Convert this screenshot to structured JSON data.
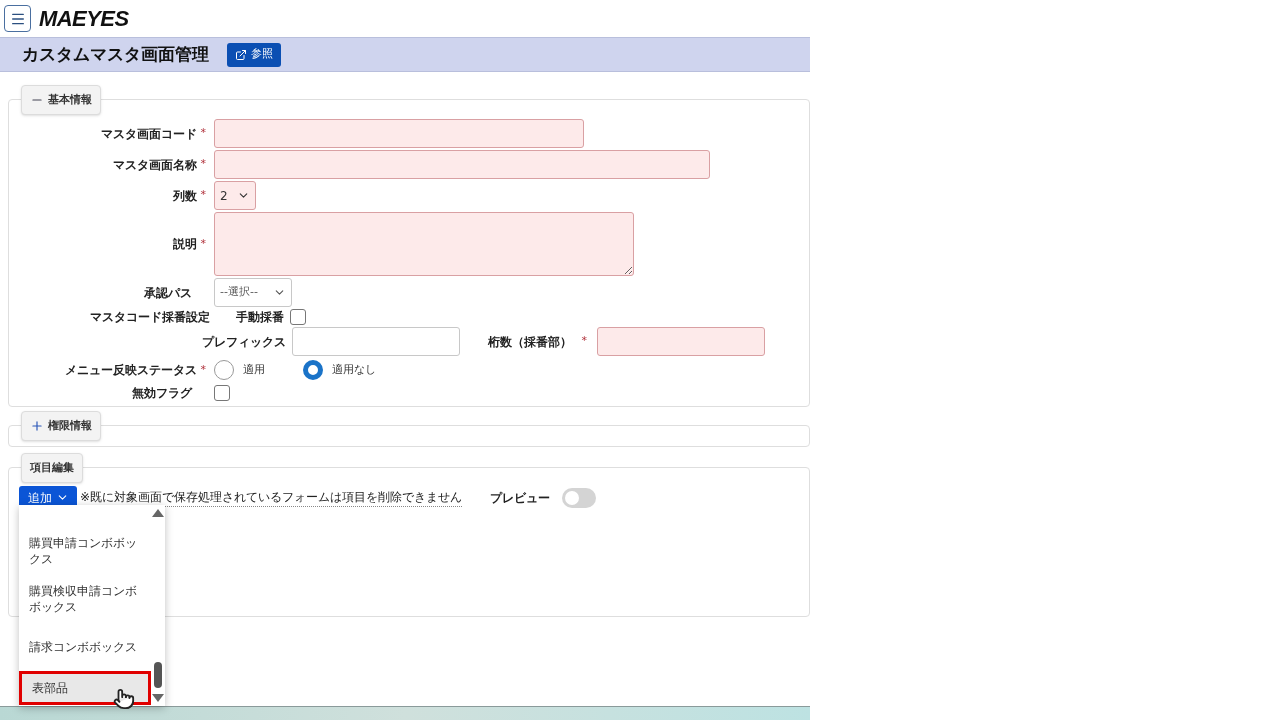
{
  "header": {
    "logo": "MAEYES"
  },
  "page": {
    "title": "カスタムマスタ画面管理",
    "reference_button": "参照"
  },
  "basic_section": {
    "title": "基本情報",
    "expanded": true,
    "code_field": {
      "label": "マスタ画面コード",
      "required_mark": "*"
    },
    "name_field": {
      "label": "マスタ画面名称",
      "required_mark": "*"
    },
    "columns_field": {
      "label": "列数",
      "required_mark": "*",
      "value": "2"
    },
    "description_field": {
      "label": "説明",
      "required_mark": "*"
    },
    "approval_field": {
      "label": "承認パス",
      "value": "--選択--"
    },
    "numbering": {
      "label": "マスタコード採番設定",
      "manual": {
        "label": "手動採番",
        "checked": false
      },
      "prefix": {
        "label": "プレフィックス"
      },
      "digits": {
        "label": "桁数（採番部）",
        "required_mark": "*"
      }
    },
    "menu_status": {
      "label": "メニュー反映ステータス",
      "required_mark": "*",
      "options": [
        {
          "label": "適用",
          "selected": false
        },
        {
          "label": "適用なし",
          "selected": true
        }
      ]
    },
    "disabled_flag": {
      "label": "無効フラグ",
      "checked": false
    }
  },
  "permission_section": {
    "title": "権限情報",
    "expanded": false
  },
  "items_section": {
    "title": "項目編集",
    "add_button": "追加",
    "notice": "※既に対象画面で保存処理されているフォームは項目を削除できません",
    "preview": {
      "label": "プレビュー",
      "on": false
    },
    "dropdown_items": [
      {
        "label": "購買申請コンボボックス",
        "selected": false
      },
      {
        "label": "購買検収申請コンボボックス",
        "selected": false
      },
      {
        "label": "請求コンボボックス",
        "selected": false
      },
      {
        "label": "表部品",
        "selected": true
      }
    ]
  }
}
